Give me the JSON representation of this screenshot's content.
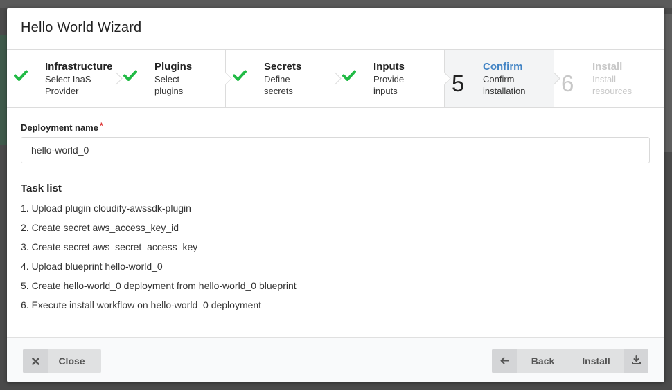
{
  "wizard": {
    "title": "Hello World Wizard"
  },
  "steps": [
    {
      "title": "Infrastructure",
      "desc_line1": "Select IaaS",
      "desc_line2": "Provider",
      "state": "done",
      "icon": "check-icon"
    },
    {
      "title": "Plugins",
      "desc_line1": "Select",
      "desc_line2": "plugins",
      "state": "done",
      "icon": "check-icon"
    },
    {
      "title": "Secrets",
      "desc_line1": "Define",
      "desc_line2": "secrets",
      "state": "done",
      "icon": "check-icon"
    },
    {
      "title": "Inputs",
      "desc_line1": "Provide",
      "desc_line2": "inputs",
      "state": "done",
      "icon": "check-icon"
    },
    {
      "title": "Confirm",
      "desc_line1": "Confirm",
      "desc_line2": "installation",
      "state": "active",
      "number": "5"
    },
    {
      "title": "Install",
      "desc_line1": "Install",
      "desc_line2": "resources",
      "state": "disabled",
      "number": "6"
    }
  ],
  "form": {
    "deployment_label": "Deployment name",
    "required_mark": "*",
    "deployment_value": "hello-world_0"
  },
  "tasks": {
    "heading": "Task list",
    "items": [
      "1. Upload plugin cloudify-awssdk-plugin",
      "2. Create secret aws_access_key_id",
      "3. Create secret aws_secret_access_key",
      "4. Upload blueprint hello-world_0",
      "5. Create hello-world_0 deployment from hello-world_0 blueprint",
      "6. Execute install workflow on hello-world_0 deployment"
    ]
  },
  "footer": {
    "close_label": "Close",
    "back_label": "Back",
    "install_label": "Install"
  },
  "colors": {
    "check": "#21ba45",
    "active_title": "#4183c4",
    "required": "#db2828",
    "button_bg": "#e0e1e2"
  }
}
